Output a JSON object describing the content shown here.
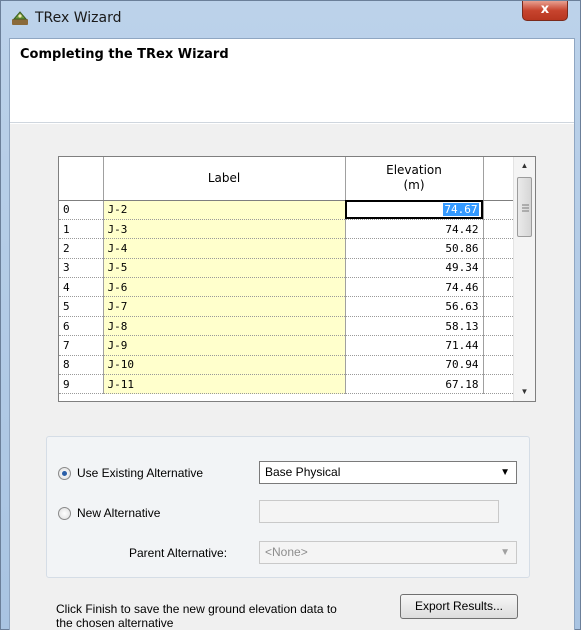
{
  "window": {
    "title": "TRex Wizard",
    "close_glyph": "x",
    "app_icon": "trex-wizard-icon"
  },
  "header": {
    "title": "Completing the TRex Wizard"
  },
  "grid": {
    "columns": {
      "label": "Label",
      "elevation_line1": "Elevation",
      "elevation_line2": "(m)"
    },
    "rows": [
      {
        "index": "0",
        "label": "J-2",
        "elevation": "74.67"
      },
      {
        "index": "1",
        "label": "J-3",
        "elevation": "74.42"
      },
      {
        "index": "2",
        "label": "J-4",
        "elevation": "50.86"
      },
      {
        "index": "3",
        "label": "J-5",
        "elevation": "49.34"
      },
      {
        "index": "4",
        "label": "J-6",
        "elevation": "74.46"
      },
      {
        "index": "5",
        "label": "J-7",
        "elevation": "56.63"
      },
      {
        "index": "6",
        "label": "J-8",
        "elevation": "58.13"
      },
      {
        "index": "7",
        "label": "J-9",
        "elevation": "71.44"
      },
      {
        "index": "8",
        "label": "J-10",
        "elevation": "70.94"
      },
      {
        "index": "9",
        "label": "J-11",
        "elevation": "67.18"
      }
    ],
    "scroll_up_glyph": "▲",
    "scroll_down_glyph": "▼"
  },
  "options": {
    "use_existing": {
      "label": "Use Existing Alternative",
      "checked": true,
      "value": "Base Physical"
    },
    "new_alternative": {
      "label": "New Alternative",
      "checked": false,
      "value": ""
    },
    "parent": {
      "label": "Parent Alternative:",
      "value": "<None>"
    },
    "combo_caret": "▼"
  },
  "footer": {
    "text": "Click Finish to save the new ground elevation data to the chosen alternative",
    "export_label": "Export Results..."
  },
  "colors": {
    "label_cell_bg": "#ffffcc",
    "selection_bg": "#3399ff",
    "close_button": "#c7442e"
  }
}
